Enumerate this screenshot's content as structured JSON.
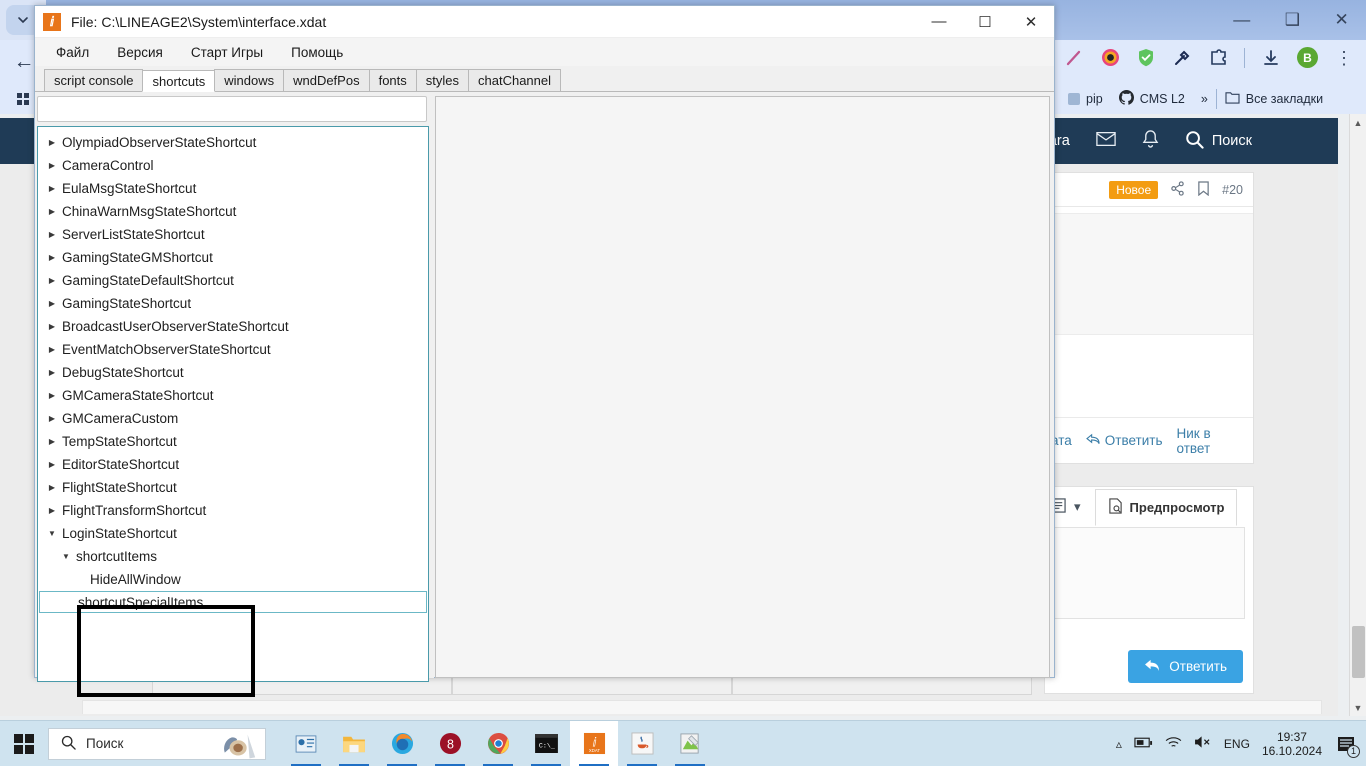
{
  "browser": {
    "window_controls": [
      "minimize",
      "restore",
      "close"
    ],
    "tab_chevron_icon": "chevron-down-icon",
    "back_icon": "arrow-left-icon",
    "apps_grid_icon": "grid-icon",
    "extensions": [
      {
        "name": "pen-extension-icon"
      },
      {
        "name": "camera-extension-icon"
      },
      {
        "name": "shield-check-icon"
      },
      {
        "name": "eyedropper-icon"
      },
      {
        "name": "puzzle-extension-icon"
      },
      {
        "name": "download-icon"
      },
      {
        "name": "profile-avatar",
        "label": "B"
      },
      {
        "name": "kebab-menu-icon"
      }
    ],
    "bookmarks": [
      {
        "label": "pip",
        "icon": "bookmark-favicon"
      },
      {
        "label": "CMS L2",
        "icon": "github-icon"
      },
      {
        "label": "»",
        "icon": "overflow-icon"
      },
      {
        "label": "Все закладки",
        "icon": "folder-icon"
      }
    ]
  },
  "site": {
    "header": {
      "user_fragment": "Dara",
      "mail_icon": "envelope-icon",
      "bell_icon": "bell-icon",
      "search_label": "Поиск",
      "search_icon": "search-icon",
      "bg_color": "#1f3b56"
    },
    "post": {
      "badge": "Новое",
      "badge_color": "#f39c12",
      "share_icon": "share-icon",
      "bookmark_icon": "bookmark-icon",
      "post_number": "#20",
      "actions": {
        "quote_fragment": "тата",
        "reply_label": "Ответить",
        "reply_icon": "reply-arrow-icon",
        "nick_label": "Ник в ответ"
      }
    },
    "editor": {
      "source_icon": "source-code-icon",
      "dropdown_caret": "caret-down-icon",
      "preview_label": "Предпросмотр",
      "preview_icon": "preview-document-icon",
      "submit_label": "Ответить",
      "submit_icon": "reply-arrow-icon",
      "submit_color": "#3aa3e3"
    },
    "scrollbar": {
      "up_arrow": "scroll-up-arrow",
      "down_arrow": "scroll-down-arrow"
    }
  },
  "app": {
    "icon": "xdat-app-icon",
    "title": "File: C:\\LINEAGE2\\System\\interface.xdat",
    "window_buttons": {
      "minimize": "—",
      "maximize": "☐",
      "close": "✕"
    },
    "menu": [
      {
        "label": "Файл"
      },
      {
        "label": "Версия"
      },
      {
        "label": "Старт Игры"
      },
      {
        "label": "Помощь"
      }
    ],
    "tabs": [
      {
        "label": "script console",
        "active": false
      },
      {
        "label": "shortcuts",
        "active": true
      },
      {
        "label": "windows",
        "active": false
      },
      {
        "label": "wndDefPos",
        "active": false
      },
      {
        "label": "fonts",
        "active": false
      },
      {
        "label": "styles",
        "active": false
      },
      {
        "label": "chatChannel",
        "active": false
      }
    ],
    "search": {
      "value": "",
      "placeholder": ""
    },
    "tree": [
      {
        "label": "OlympiadObserverStateShortcut",
        "depth": 0,
        "state": "collapsed"
      },
      {
        "label": "CameraControl",
        "depth": 0,
        "state": "collapsed"
      },
      {
        "label": "EulaMsgStateShortcut",
        "depth": 0,
        "state": "collapsed"
      },
      {
        "label": "ChinaWarnMsgStateShortcut",
        "depth": 0,
        "state": "collapsed"
      },
      {
        "label": "ServerListStateShortcut",
        "depth": 0,
        "state": "collapsed"
      },
      {
        "label": "GamingStateGMShortcut",
        "depth": 0,
        "state": "collapsed"
      },
      {
        "label": "GamingStateDefaultShortcut",
        "depth": 0,
        "state": "collapsed"
      },
      {
        "label": "GamingStateShortcut",
        "depth": 0,
        "state": "collapsed"
      },
      {
        "label": "BroadcastUserObserverStateShortcut",
        "depth": 0,
        "state": "collapsed"
      },
      {
        "label": "EventMatchObserverStateShortcut",
        "depth": 0,
        "state": "collapsed"
      },
      {
        "label": "DebugStateShortcut",
        "depth": 0,
        "state": "collapsed"
      },
      {
        "label": "GMCameraStateShortcut",
        "depth": 0,
        "state": "collapsed"
      },
      {
        "label": "GMCameraCustom",
        "depth": 0,
        "state": "collapsed"
      },
      {
        "label": "TempStateShortcut",
        "depth": 0,
        "state": "collapsed"
      },
      {
        "label": "EditorStateShortcut",
        "depth": 0,
        "state": "collapsed"
      },
      {
        "label": "FlightStateShortcut",
        "depth": 0,
        "state": "collapsed"
      },
      {
        "label": "FlightTransformShortcut",
        "depth": 0,
        "state": "collapsed"
      },
      {
        "label": "LoginStateShortcut",
        "depth": 0,
        "state": "expanded"
      },
      {
        "label": "shortcutItems",
        "depth": 1,
        "state": "expanded"
      },
      {
        "label": "HideAllWindow",
        "depth": 2,
        "state": "leaf"
      },
      {
        "label": "shortcutSpecialItems",
        "depth": 1,
        "state": "leaf",
        "selected": true
      }
    ]
  },
  "taskbar": {
    "start_icon": "windows-start-icon",
    "search": {
      "placeholder": "Поиск",
      "icon": "search-icon",
      "cortana_icon": "cortana-icon"
    },
    "apps": [
      {
        "name": "task-view-icon",
        "active": false
      },
      {
        "name": "file-explorer-icon",
        "active": false
      },
      {
        "name": "firefox-icon",
        "active": false
      },
      {
        "name": "opera-gx-icon",
        "active": false
      },
      {
        "name": "chrome-icon",
        "active": false
      },
      {
        "name": "command-prompt-icon",
        "active": false
      },
      {
        "name": "xdat-editor-icon",
        "active": true
      },
      {
        "name": "java-icon",
        "active": false
      },
      {
        "name": "notepad-plus-icon",
        "active": false
      }
    ],
    "tray": {
      "chevron_icon": "show-hidden-icons",
      "battery_icon": "battery-icon",
      "network_icon": "wifi-icon",
      "volume_icon": "volume-muted-icon",
      "language": "ENG",
      "time": "19:37",
      "date": "16.10.2024",
      "notification_icon": "notifications-icon",
      "notification_count": "1"
    }
  }
}
